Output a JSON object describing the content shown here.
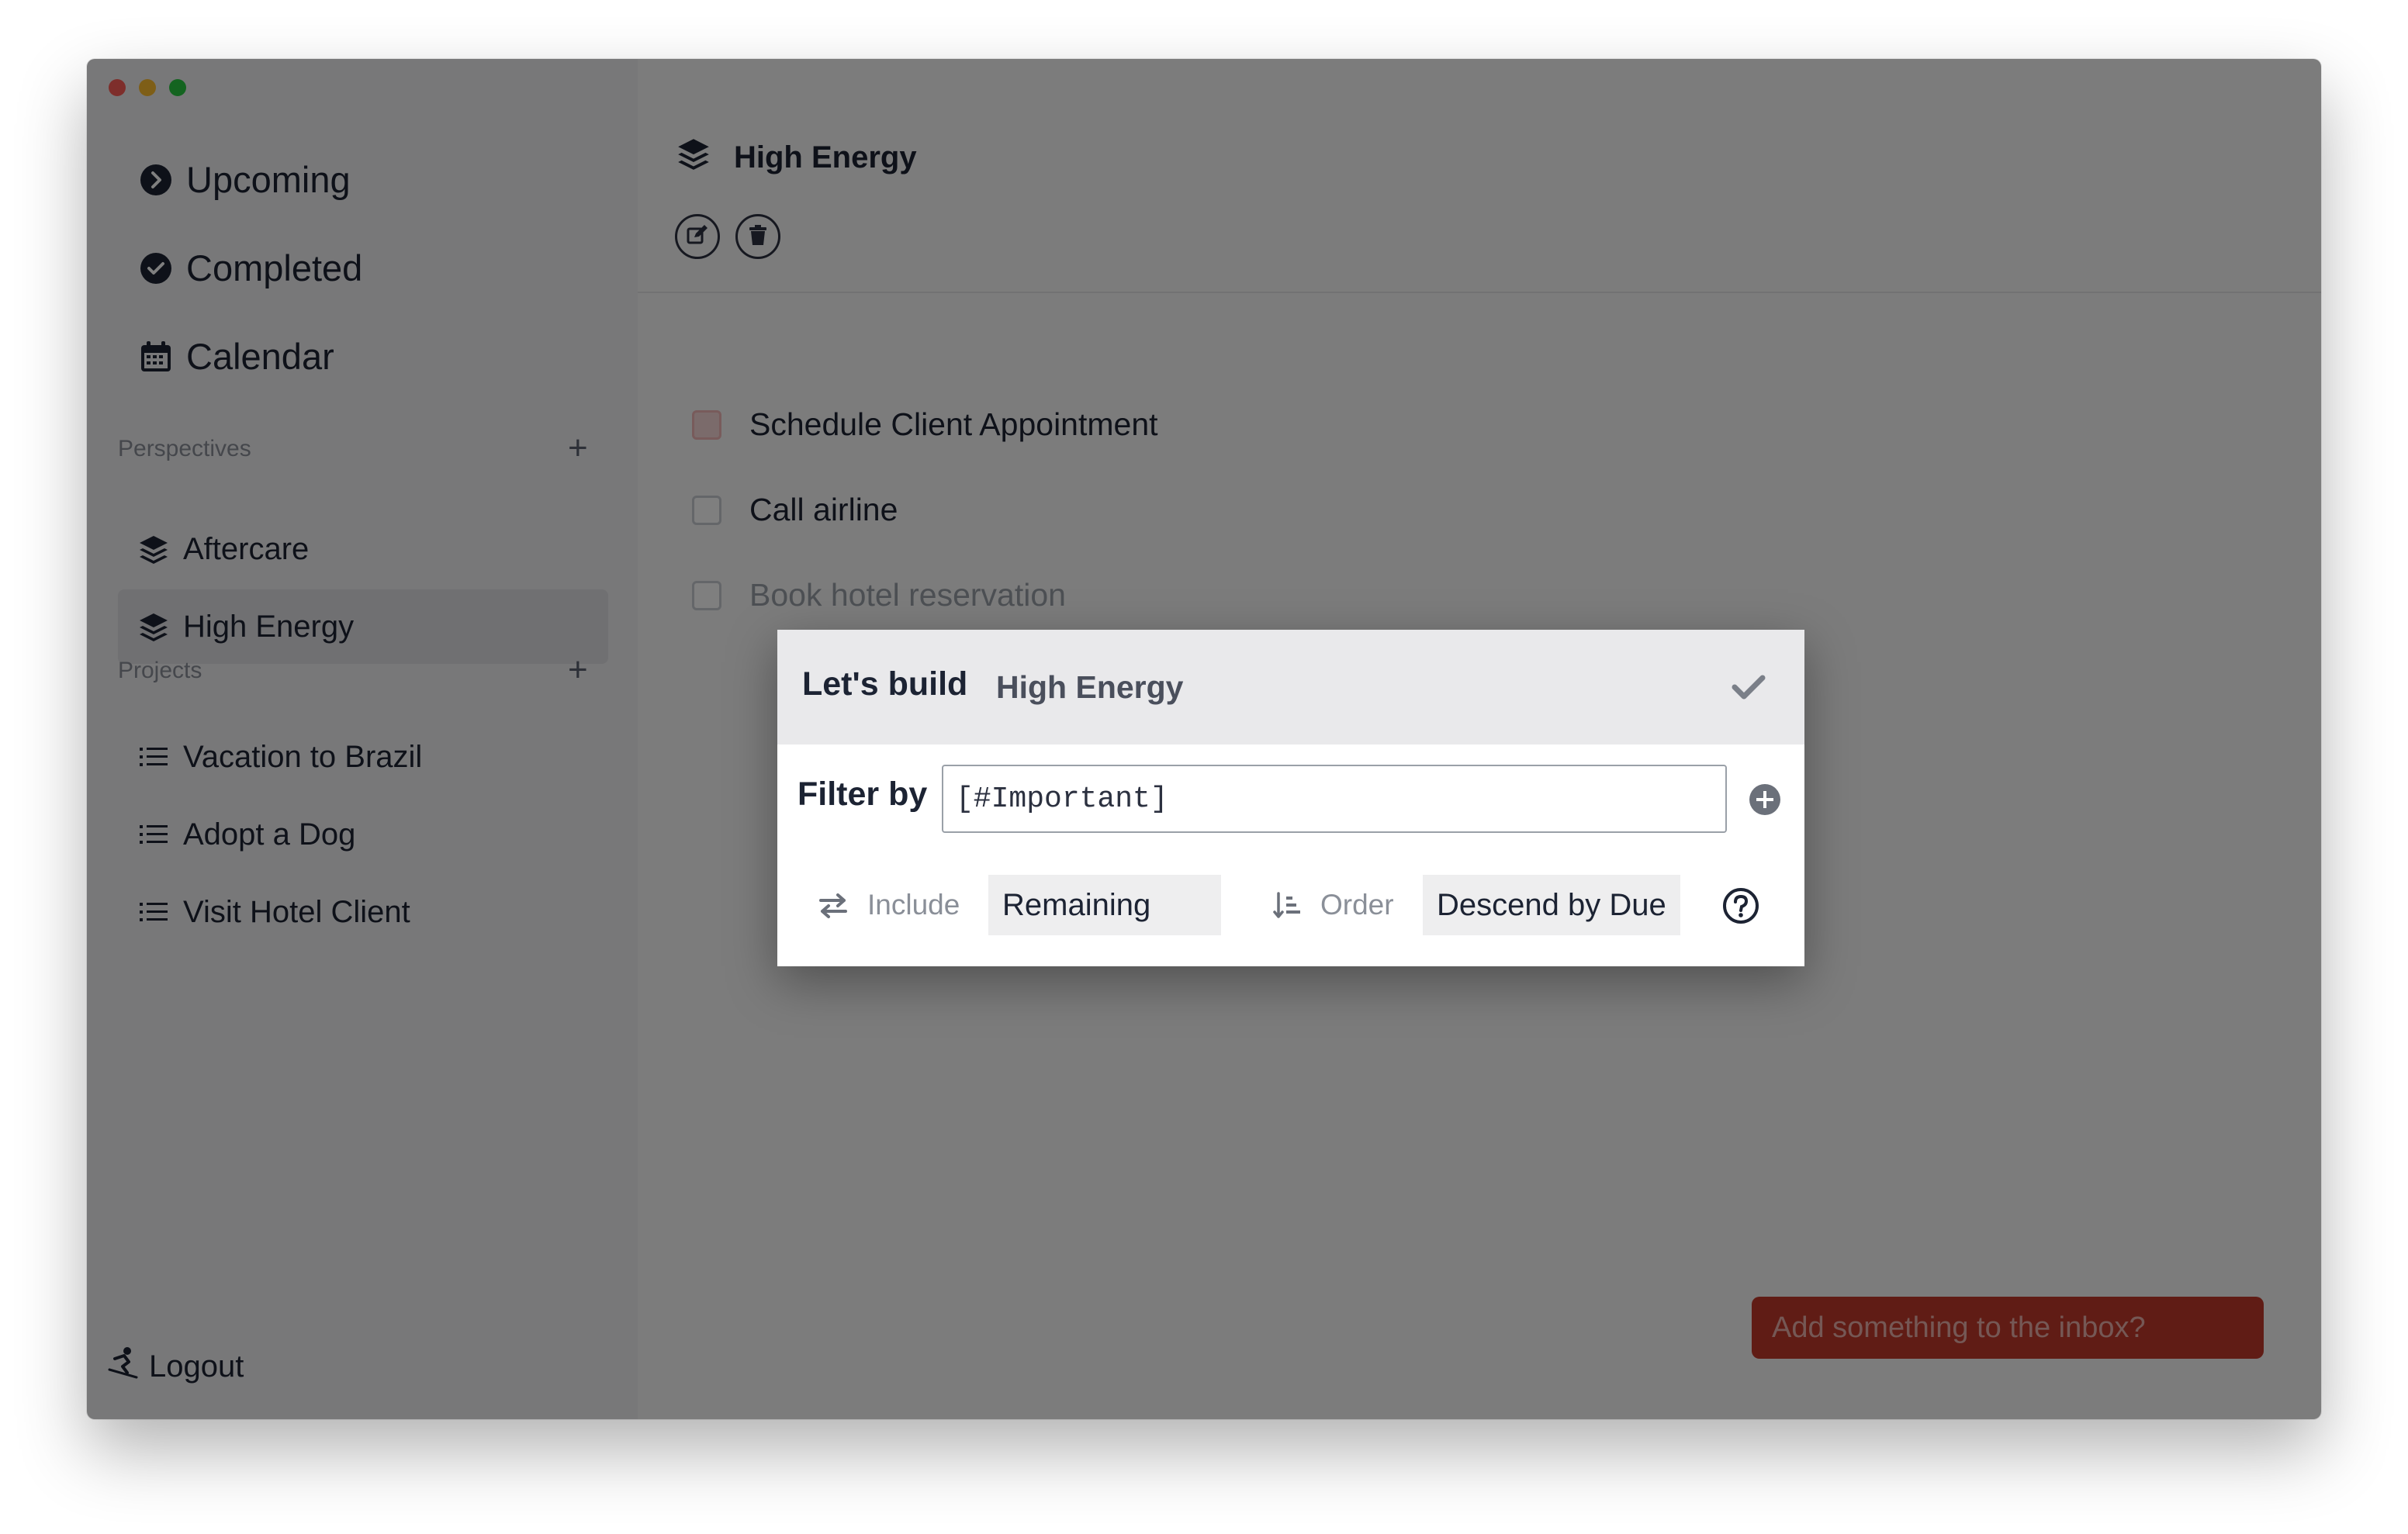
{
  "sidebar": {
    "nav": [
      {
        "label": "Upcoming",
        "icon": "chevron-circle-right-icon"
      },
      {
        "label": "Completed",
        "icon": "check-circle-icon"
      },
      {
        "label": "Calendar",
        "icon": "calendar-icon"
      }
    ],
    "perspectives_label": "Perspectives",
    "perspectives": [
      {
        "label": "Aftercare",
        "icon": "layers-icon"
      },
      {
        "label": "High Energy",
        "icon": "layers-icon",
        "active": true
      }
    ],
    "projects_label": "Projects",
    "projects": [
      {
        "label": "Vacation to Brazil",
        "icon": "list-icon"
      },
      {
        "label": "Adopt a Dog",
        "icon": "list-icon"
      },
      {
        "label": "Visit Hotel Client",
        "icon": "list-icon"
      }
    ],
    "logout_label": "Logout"
  },
  "main": {
    "title": "High Energy",
    "tasks": [
      {
        "label": "Schedule Client Appointment",
        "important": true
      },
      {
        "label": "Call airline",
        "important": false
      },
      {
        "label": "Book hotel reservation",
        "important": false
      }
    ],
    "inbox_placeholder": "Add something to the inbox?"
  },
  "modal": {
    "heading": "Let's build",
    "name_value": "High Energy",
    "filter_label": "Filter by",
    "filter_value": "[#Important]",
    "include_label": "Include",
    "include_value": "Remaining",
    "order_label": "Order",
    "order_value": "Descend by Due"
  },
  "colors": {
    "accent_red": "#c0392b",
    "text_dark": "#1c2333",
    "overlay": "rgba(0,0,0,0.5)"
  }
}
